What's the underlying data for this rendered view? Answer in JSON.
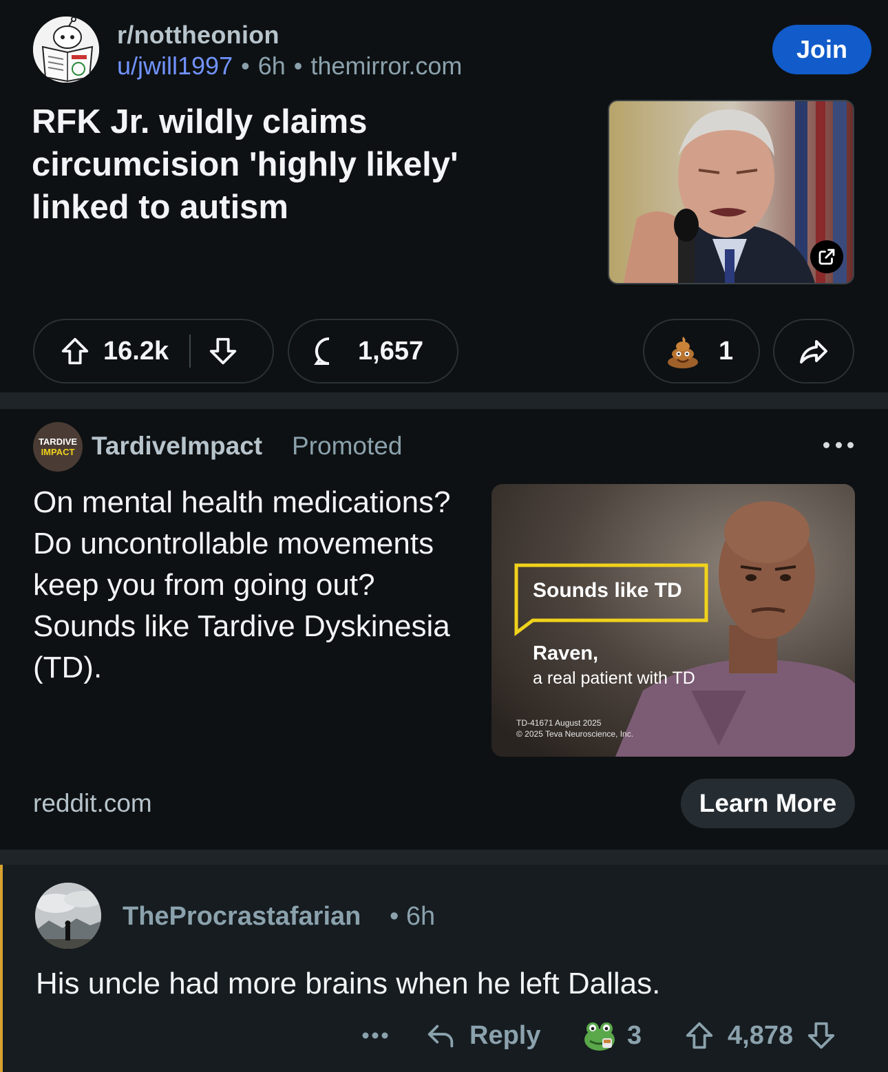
{
  "post": {
    "subreddit": "r/nottheonion",
    "username": "u/jwill1997",
    "time": "6h",
    "domain": "themirror.com",
    "join_label": "Join",
    "title": "RFK Jr. wildly claims circumcision 'highly likely' linked to autism",
    "upvotes": "16.2k",
    "comments": "1,657",
    "awards": "1"
  },
  "ad": {
    "avatar_line1": "TARDIVE",
    "avatar_line2": "IMPACT",
    "advertiser": "TardiveImpact",
    "promoted": "Promoted",
    "text": "On mental health medications? Do uncontrollable movements keep you from going out? Sounds like Tardive Dyskinesia (TD).",
    "image_headline": "Sounds like TD",
    "image_name": "Raven,",
    "image_caption": "a real patient with TD",
    "image_legal1": "TD-41671 August 2025",
    "image_legal2": "© 2025 Teva Neuroscience, Inc.",
    "domain": "reddit.com",
    "cta": "Learn More"
  },
  "comment": {
    "username": "TheProcrastafarian",
    "time": "6h",
    "body": "His uncle had more brains when he left Dallas.",
    "reply_label": "Reply",
    "awards": "3",
    "score": "4,878"
  },
  "colors": {
    "background": "#0e1113",
    "join_button": "#115bca",
    "username_link": "#7193ff",
    "comment_bar": "#d7a230",
    "ad_box_yellow": "#f0d21c"
  }
}
